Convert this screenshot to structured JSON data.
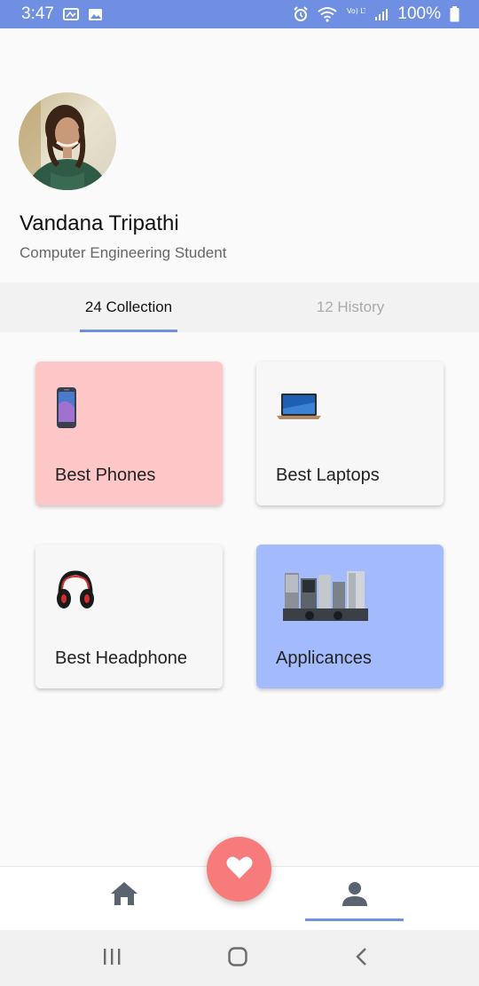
{
  "status_bar": {
    "time": "3:47",
    "battery": "100%",
    "left_icons": [
      "gallery-sync-icon",
      "image-icon"
    ],
    "right_icons": [
      "alarm-icon",
      "wifi-icon",
      "volte-icon",
      "signal-icon",
      "battery-icon"
    ],
    "background": "#6f8fe3",
    "network_label": "Vo) LTE1"
  },
  "profile": {
    "name": "Vandana Tripathi",
    "role": "Computer Engineering Student"
  },
  "tabs": [
    {
      "label": "24 Collection",
      "active": true
    },
    {
      "label": "12 History",
      "active": false
    }
  ],
  "collections": [
    {
      "label": "Best Phones",
      "icon": "phone-icon",
      "color": "#fec7c7"
    },
    {
      "label": "Best Laptops",
      "icon": "laptop-icon",
      "color": "#f7f7f7"
    },
    {
      "label": "Best Headphone",
      "icon": "headphone-icon",
      "color": "#f7f7f7"
    },
    {
      "label": "Applicances",
      "icon": "appliances-icon",
      "color": "#a3bbfc"
    }
  ],
  "bottom_nav": {
    "items": [
      "home-icon",
      "favorite-icon",
      "profile-icon"
    ],
    "active": "profile-icon",
    "fab_color": "#f77b7b"
  },
  "system_nav": [
    "recents-icon",
    "home-circle-icon",
    "back-icon"
  ]
}
